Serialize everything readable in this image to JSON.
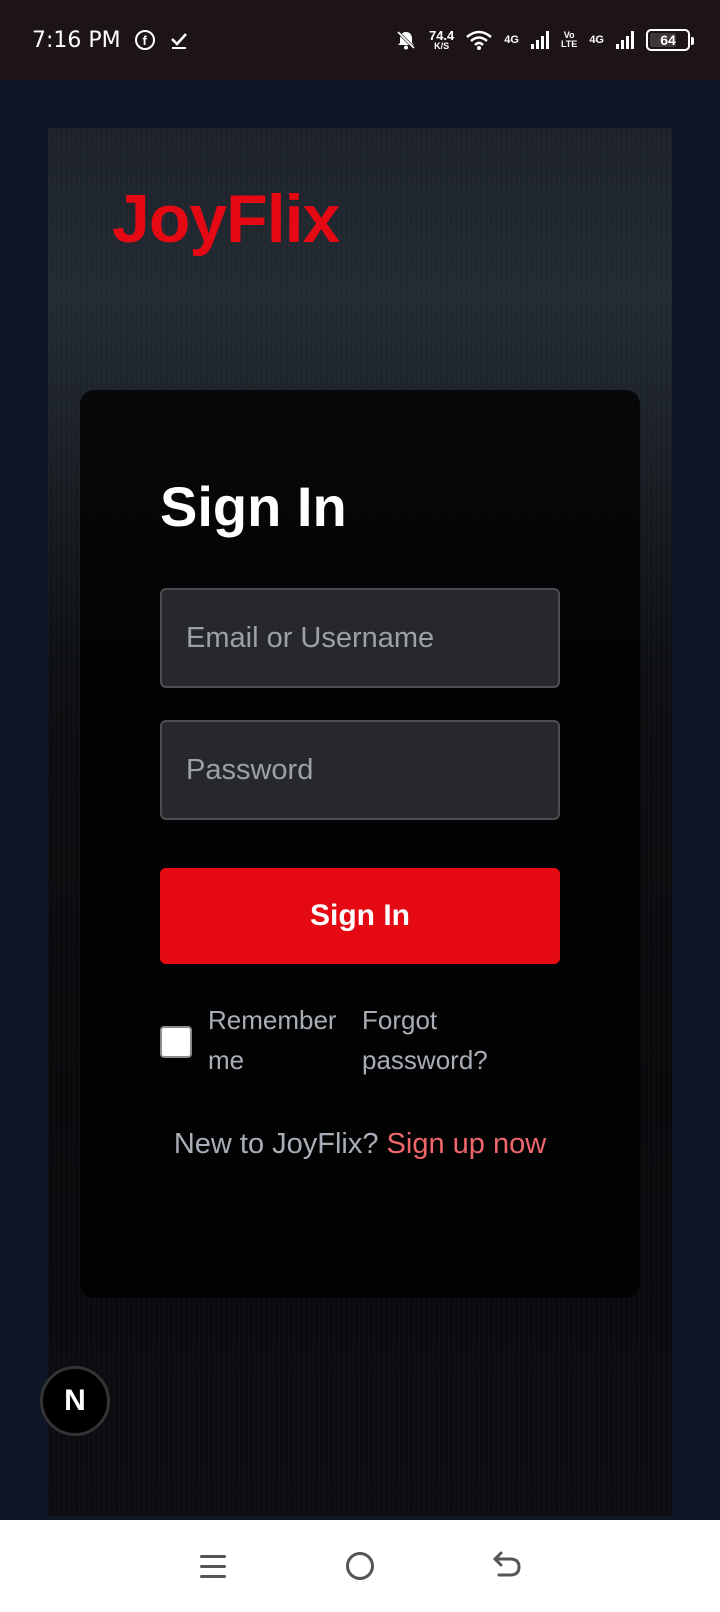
{
  "status_bar": {
    "time": "7:16 PM",
    "speed_value": "74.4",
    "speed_unit": "K/S",
    "network_1": "4G",
    "volte_top": "Vo",
    "volte_bottom": "LTE",
    "network_2": "4G",
    "battery": "64",
    "icons": [
      "facebook-icon",
      "check-icon",
      "bell-off-icon",
      "wifi-icon",
      "signal-icon",
      "battery-icon"
    ]
  },
  "app": {
    "logo": "JoyFlix",
    "brand_color": "#e50914"
  },
  "signin_card": {
    "title": "Sign In",
    "email_placeholder": "Email or Username",
    "password_placeholder": "Password",
    "submit_label": "Sign In",
    "remember_label": "Remember me",
    "remember_checked": false,
    "forgot_label": "Forgot password?",
    "signup_prefix": "New to JoyFlix?",
    "signup_link": "Sign up now"
  },
  "dev_badge": {
    "label": "N"
  },
  "nav_bar": {
    "icons": [
      "menu-icon",
      "home-icon",
      "back-icon"
    ]
  }
}
